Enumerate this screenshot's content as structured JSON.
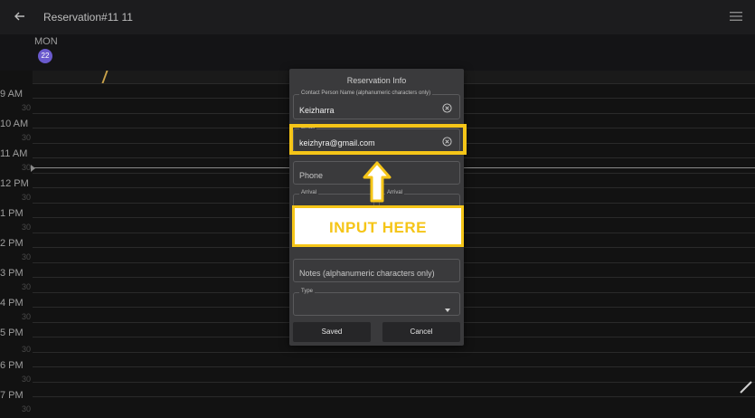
{
  "appbar": {
    "title": "Reservation#11 11"
  },
  "calendar": {
    "day_name": "MON",
    "day_number": "22",
    "hours": [
      "9 AM",
      "10 AM",
      "11 AM",
      "12 PM",
      "1 PM",
      "2 PM",
      "3 PM",
      "4 PM",
      "5 PM",
      "6 PM",
      "7 PM"
    ],
    "half_label": "30"
  },
  "dialog": {
    "title": "Reservation Info",
    "contact": {
      "label": "Contact Person Name (alphanumeric characters only)",
      "value": "Keizharra"
    },
    "email": {
      "label": "Email",
      "value": "keizhyra@gmail.com"
    },
    "phone": {
      "placeholder": "Phone"
    },
    "arrival_left": {
      "label": "Arrival"
    },
    "arrival_right": {
      "label": "Arrival"
    },
    "notes": {
      "placeholder": "Notes (alphanumeric characters only)"
    },
    "type": {
      "label": "Type"
    },
    "save_label": "Saved",
    "cancel_label": "Cancel"
  },
  "annotation": {
    "callout_text": "INPUT HERE"
  },
  "colors": {
    "accent": "#f5c518",
    "day_badge": "#6a5acd",
    "dialog_bg": "#3a3a3c"
  }
}
